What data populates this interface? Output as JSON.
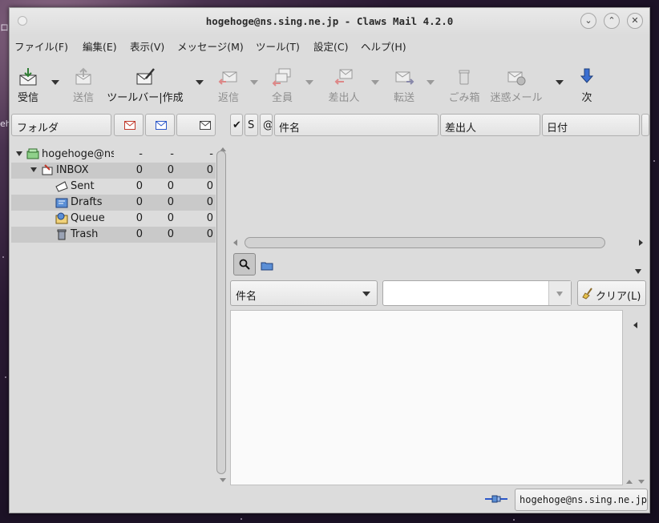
{
  "desktop": {
    "edge_glyph": "ロ",
    "edge_glyph_2": "eh"
  },
  "window": {
    "title": "hogehoge@ns.sing.ne.jp - Claws Mail 4.2.0",
    "controls": {
      "minimize": "⌄",
      "maximize": "⌃",
      "close": "✕"
    }
  },
  "menubar": {
    "items": [
      "ファイル(F)",
      "編集(E)",
      "表示(V)",
      "メッセージ(M)",
      "ツール(T)",
      "設定(C)",
      "ヘルプ(H)"
    ]
  },
  "toolbar": {
    "receive": "受信",
    "send": "送信",
    "compose": "ツールバー|作成",
    "reply": "返信",
    "reply_all": "全員",
    "reply_sender": "差出人",
    "forward": "転送",
    "trash": "ごみ箱",
    "spam": "迷惑メール",
    "next": "次"
  },
  "folder_pane": {
    "header": {
      "name": "フォルダ"
    },
    "rows": [
      {
        "name": "hogehoge@ns",
        "unread": "-",
        "new": "-",
        "total": "-"
      },
      {
        "name": "INBOX",
        "unread": "0",
        "new": "0",
        "total": "0"
      },
      {
        "name": "Sent",
        "unread": "0",
        "new": "0",
        "total": "0"
      },
      {
        "name": "Drafts",
        "unread": "0",
        "new": "0",
        "total": "0"
      },
      {
        "name": "Queue",
        "unread": "0",
        "new": "0",
        "total": "0"
      },
      {
        "name": "Trash",
        "unread": "0",
        "new": "0",
        "total": "0"
      }
    ]
  },
  "message_list": {
    "columns": {
      "mark": "✔",
      "status": "S",
      "attach": "@",
      "subject": "件名",
      "from": "差出人",
      "date": "日付"
    }
  },
  "quicksearch": {
    "field": "件名",
    "value": "",
    "clear_label": "クリア(L)"
  },
  "statusbar": {
    "account": "hogehoge@ns.sing.ne.jp"
  },
  "colors": {
    "window_bg": "#dcdcdc",
    "selected_row": "#c9c9c9",
    "accent_blue": "#2b57c9",
    "mail_red": "#c0392b"
  }
}
